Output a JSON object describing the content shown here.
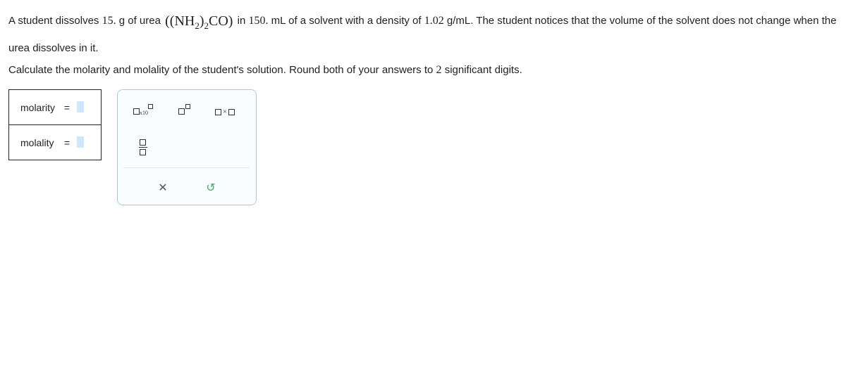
{
  "problem": {
    "p1_a": "A student dissolves ",
    "mass": "15.",
    "p1_b": " g of urea ",
    "formula_html": "((NH<span class=\"sub\">2</span>)<span class=\"sub\">2</span>CO)",
    "p1_c": " in ",
    "vol": "150.",
    "p1_d": " mL of a solvent with a density of ",
    "density": "1.02",
    "p1_e": " g/mL. The student notices that the volume of the solvent does not change when the urea dissolves in it.",
    "p2_a": "Calculate the molarity and molality of the student's solution. Round both of your answers to ",
    "sigfigs": "2",
    "p2_b": " significant digits."
  },
  "answers": {
    "molarity_label": "molarity",
    "molality_label": "molality",
    "equals": "="
  },
  "tools": {
    "sci": "x10",
    "times": "×",
    "close": "✕",
    "reset": "↺"
  }
}
